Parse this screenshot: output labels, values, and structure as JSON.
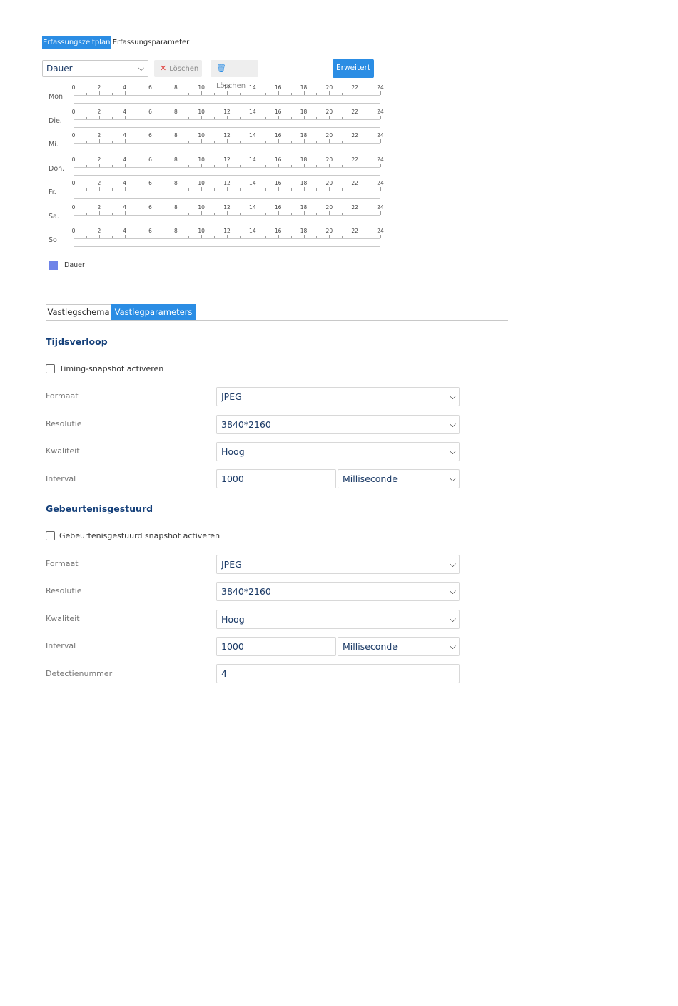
{
  "top_tabs": [
    "Erfassungszeitplan",
    "Erfassungsparameter"
  ],
  "toolbar": {
    "type_select": "Dauer",
    "clear_label": "Löschen",
    "clear_all_label": "Löschen",
    "advanced_label": "Erweitert"
  },
  "schedule": {
    "ticks": [
      "0",
      "2",
      "4",
      "6",
      "8",
      "10",
      "12",
      "14",
      "16",
      "18",
      "20",
      "22",
      "24"
    ],
    "days": [
      "Mon.",
      "Die.",
      "Mi.",
      "Don.",
      "Fr.",
      "Sa.",
      "So"
    ]
  },
  "legend": {
    "label": "Dauer",
    "color": "#6e83e8"
  },
  "lower_tabs": [
    "Vastlegschema",
    "Vastlegparameters"
  ],
  "timing": {
    "title": "Tijdsverloop",
    "checkbox_label": "Timing-snapshot activeren",
    "format_label": "Formaat",
    "format_value": "JPEG",
    "resolution_label": "Resolutie",
    "resolution_value": "3840*2160",
    "quality_label": "Kwaliteit",
    "quality_value": "Hoog",
    "interval_label": "Interval",
    "interval_value": "1000",
    "interval_unit": "Milliseconde"
  },
  "event": {
    "title": "Gebeurtenisgestuurd",
    "checkbox_label": "Gebeurtenisgestuurd snapshot activeren",
    "format_label": "Formaat",
    "format_value": "JPEG",
    "resolution_label": "Resolutie",
    "resolution_value": "3840*2160",
    "quality_label": "Kwaliteit",
    "quality_value": "Hoog",
    "interval_label": "Interval",
    "interval_value": "1000",
    "interval_unit": "Milliseconde",
    "detection_label": "Detectienummer",
    "detection_value": "4"
  },
  "colors": {
    "accent": "#2b8de4",
    "section_title": "#15407a"
  }
}
